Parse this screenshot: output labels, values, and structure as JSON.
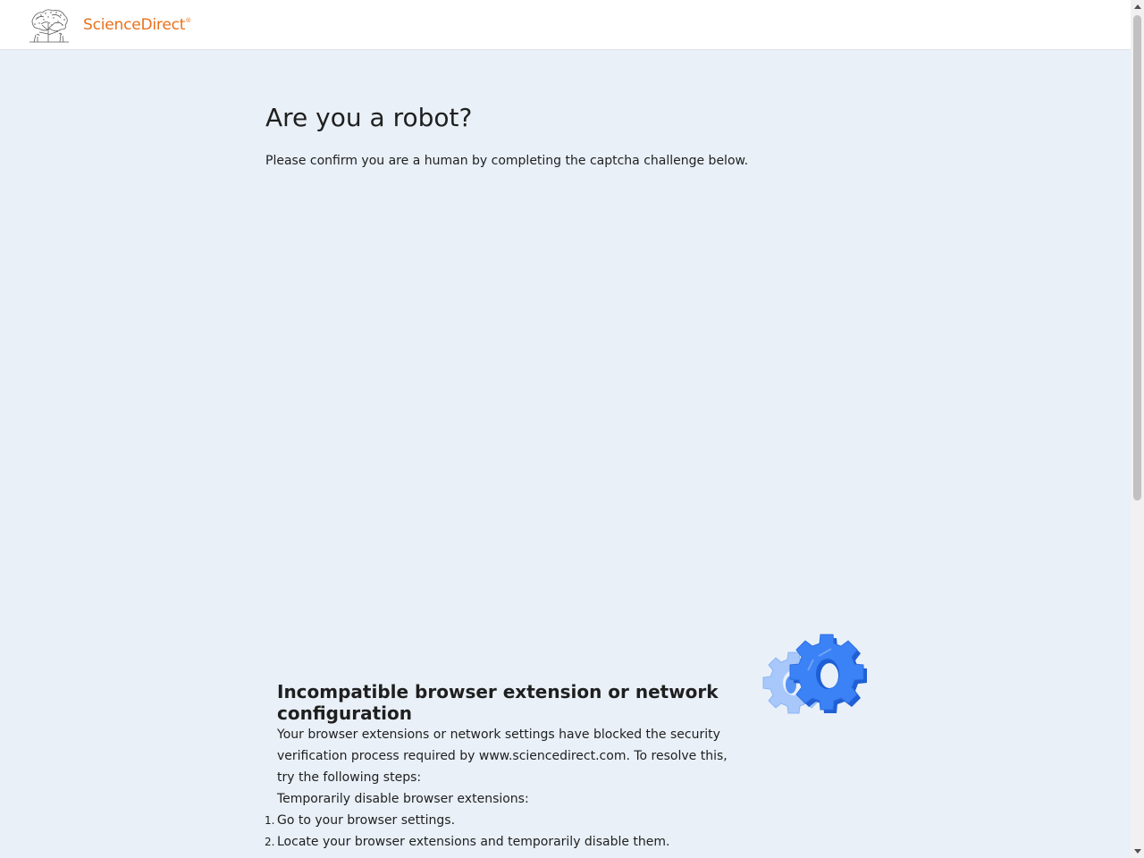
{
  "header": {
    "brand": "ScienceDirect",
    "brand_mark": "®",
    "logo_icon": "elsevier-tree-icon"
  },
  "main": {
    "title": "Are you a robot?",
    "subtitle": "Please confirm you are a human by completing the captcha challenge below."
  },
  "notice": {
    "title": "Incompatible browser extension or network configuration",
    "body": "Your browser extensions or network settings have blocked the security verification process required by www.sciencedirect.com. To resolve this, try the following steps:",
    "subheading": "Temporarily disable browser extensions:",
    "steps": [
      {
        "num": "1.",
        "text": "Go to your browser settings."
      },
      {
        "num": "2.",
        "text": "Locate your browser extensions and temporarily disable them."
      }
    ],
    "illustration_icon": "gears-icon"
  },
  "colors": {
    "brand_orange": "#e9711c",
    "page_bg": "#e9f0f8",
    "gear_blue": "#3b82f6",
    "gear_light": "#a8c8fb"
  }
}
